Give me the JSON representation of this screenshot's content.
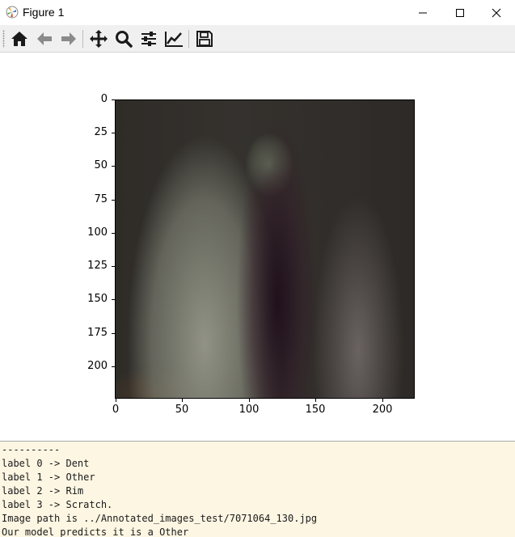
{
  "window": {
    "title": "Figure 1",
    "icon": "matplotlib-icon"
  },
  "toolbar": {
    "tools": [
      {
        "name": "home-icon",
        "tooltip": "Reset original view"
      },
      {
        "name": "back-icon",
        "tooltip": "Back to previous view"
      },
      {
        "name": "forward-icon",
        "tooltip": "Forward to next view"
      },
      {
        "name": "pan-icon",
        "tooltip": "Pan axes"
      },
      {
        "name": "zoom-icon",
        "tooltip": "Zoom to rectangle"
      },
      {
        "name": "subplots-icon",
        "tooltip": "Configure subplots"
      },
      {
        "name": "edit-axis-icon",
        "tooltip": "Edit axis, curve and image parameters"
      },
      {
        "name": "save-icon",
        "tooltip": "Save the figure"
      }
    ]
  },
  "figure": {
    "y_ticks": [
      "0",
      "25",
      "50",
      "75",
      "100",
      "125",
      "150",
      "175",
      "200"
    ],
    "x_ticks": [
      "0",
      "50",
      "100",
      "150",
      "200"
    ]
  },
  "console": {
    "lines": [
      "----------",
      "label 0 -> Dent",
      "label 1 -> Other",
      "label 2 -> Rim",
      "label 3 -> Scratch.",
      "Image path is ../Annotated_images_test/7071064_130.jpg",
      "Our model predicts it is a Other"
    ]
  }
}
